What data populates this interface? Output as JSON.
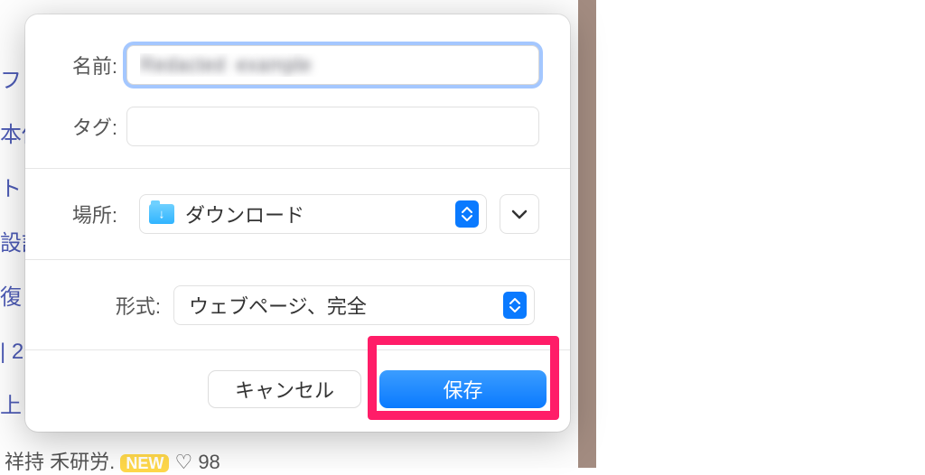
{
  "labels": {
    "name": "名前:",
    "tag": "タグ:",
    "location": "場所:",
    "format": "形式:"
  },
  "fields": {
    "name_value": "Redacted  example",
    "tag_value": "",
    "location_value": "ダウンロード",
    "format_value": "ウェブページ、完全"
  },
  "buttons": {
    "cancel": "キャンセル",
    "save": "保存"
  },
  "background": {
    "lines": [
      "フ",
      "",
      "本仮",
      "ト",
      "設記",
      "復",
      "| 2",
      "上"
    ],
    "bottom_name": "祥持 禾研労.",
    "bottom_new": "NEW",
    "bottom_count": "♡ 98"
  }
}
